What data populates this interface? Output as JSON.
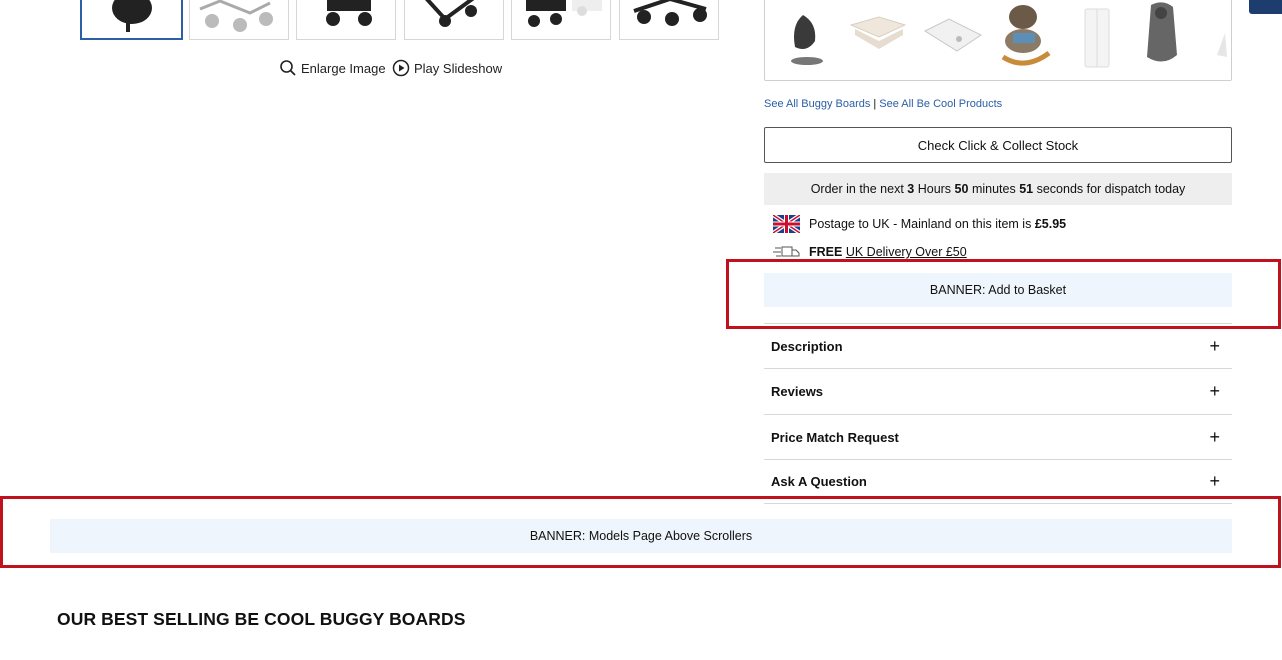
{
  "gallery": {
    "enlarge_label": "Enlarge Image",
    "slideshow_label": "Play Slideshow"
  },
  "product_links": {
    "buggy_boards": "See All Buggy Boards",
    "separator": "|",
    "brand_products": "See All Be Cool Products"
  },
  "click_collect_label": "Check Click & Collect Stock",
  "dispatch": {
    "prefix": "Order in the next",
    "hours": "3",
    "hours_label": "Hours",
    "minutes": "50",
    "minutes_label": "minutes",
    "seconds": "51",
    "suffix": "seconds for dispatch today"
  },
  "postage": {
    "text": "Postage to UK - Mainland on this item is",
    "price": "£5.95"
  },
  "free_delivery": {
    "free": "FREE",
    "text": "UK Delivery Over £50"
  },
  "banner_basket": "BANNER: Add to Basket",
  "accordion": [
    {
      "label": "Description",
      "icon": "+"
    },
    {
      "label": "Reviews",
      "icon": "+"
    },
    {
      "label": "Price Match Request",
      "icon": "+"
    },
    {
      "label": "Ask A Question",
      "icon": "+"
    }
  ],
  "banner_scrollers": "BANNER: Models Page Above Scrollers",
  "best_selling_title": "OUR BEST SELLING BE COOL BUGGY BOARDS",
  "colors": {
    "link": "#2b5fa8",
    "highlight_box": "#c0121d",
    "banner_bg": "#eef5fc"
  }
}
